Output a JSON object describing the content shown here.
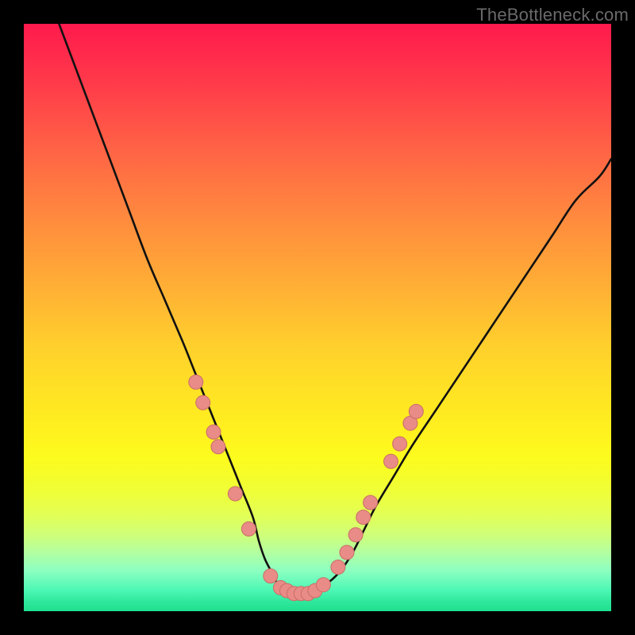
{
  "watermark": "TheBottleneck.com",
  "colors": {
    "background": "#000000",
    "curve": "#111111",
    "dot_fill": "#e98b86",
    "dot_stroke": "#c96e68",
    "gradient_top": "#ff1a4d",
    "gradient_bottom": "#20df8f"
  },
  "chart_data": {
    "type": "line",
    "title": "",
    "xlabel": "",
    "ylabel": "",
    "xlim": [
      0,
      100
    ],
    "ylim": [
      0,
      100
    ],
    "legend": false,
    "grid": false,
    "notes": "Bottleneck-style V curve. y ≈ bottleneck percentage (0 at valley floor, 100 at top). Background gradient encodes severity (green=low, red=high). Salmon dots mark sampled hardware points along the curve near the valley.",
    "series": [
      {
        "name": "bottleneck-curve",
        "x": [
          6,
          9,
          12,
          15,
          18,
          21,
          24,
          27,
          29,
          31,
          33,
          35,
          37,
          39,
          40,
          41,
          42,
          43,
          44,
          46,
          48,
          50,
          52,
          54,
          56,
          58,
          60,
          63,
          66,
          70,
          74,
          78,
          82,
          86,
          90,
          94,
          98,
          100
        ],
        "y": [
          100,
          92,
          84,
          76,
          68,
          60,
          53,
          46,
          41,
          36,
          31,
          26,
          21,
          16,
          12,
          9,
          7,
          5,
          4,
          3,
          3,
          4,
          5,
          7,
          10,
          14,
          18,
          23,
          28,
          34,
          40,
          46,
          52,
          58,
          64,
          70,
          74,
          77
        ]
      }
    ],
    "points": [
      {
        "x": 29.3,
        "y": 39.0
      },
      {
        "x": 30.5,
        "y": 35.5
      },
      {
        "x": 32.3,
        "y": 30.5
      },
      {
        "x": 33.1,
        "y": 28.0
      },
      {
        "x": 36.0,
        "y": 20.0
      },
      {
        "x": 38.3,
        "y": 14.0
      },
      {
        "x": 42.0,
        "y": 6.0
      },
      {
        "x": 43.7,
        "y": 4.0
      },
      {
        "x": 44.8,
        "y": 3.5
      },
      {
        "x": 46.0,
        "y": 3.0
      },
      {
        "x": 47.2,
        "y": 3.0
      },
      {
        "x": 48.4,
        "y": 3.0
      },
      {
        "x": 49.6,
        "y": 3.5
      },
      {
        "x": 51.0,
        "y": 4.5
      },
      {
        "x": 53.5,
        "y": 7.5
      },
      {
        "x": 55.0,
        "y": 10.0
      },
      {
        "x": 56.5,
        "y": 13.0
      },
      {
        "x": 57.8,
        "y": 16.0
      },
      {
        "x": 59.0,
        "y": 18.5
      },
      {
        "x": 62.5,
        "y": 25.5
      },
      {
        "x": 64.0,
        "y": 28.5
      },
      {
        "x": 65.8,
        "y": 32.0
      },
      {
        "x": 66.8,
        "y": 34.0
      }
    ]
  }
}
